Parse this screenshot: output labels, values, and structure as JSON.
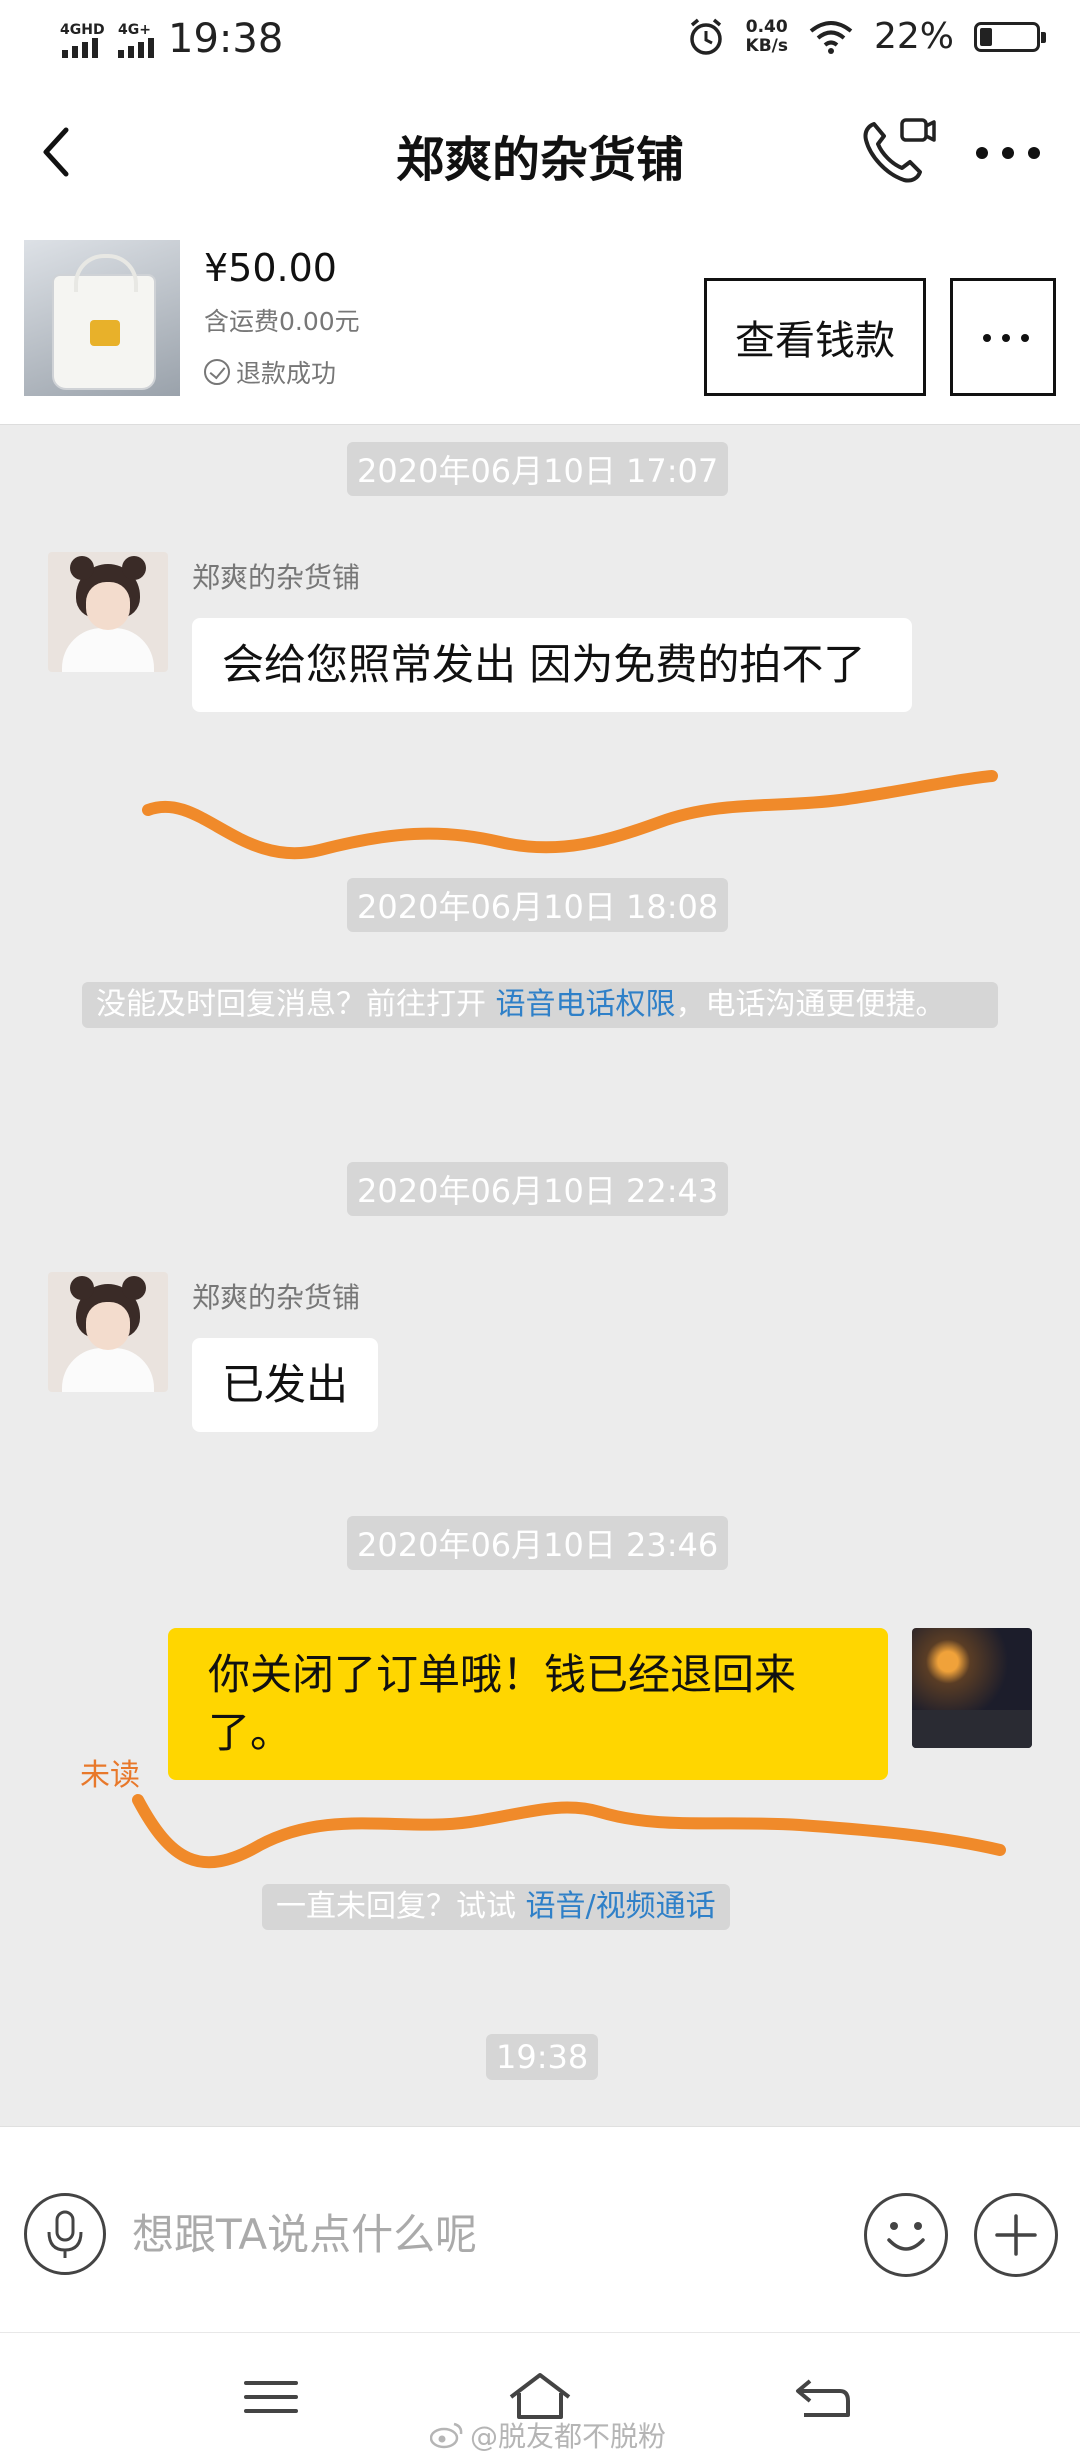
{
  "status_bar": {
    "network_1": "4GHD",
    "network_2": "4G+",
    "time": "19:38",
    "net_speed_value": "0.40",
    "net_speed_unit": "KB/s",
    "battery_percent": "22%",
    "battery_level": 0.22
  },
  "header": {
    "title": "郑爽的杂货铺"
  },
  "product": {
    "price": "¥50.00",
    "shipping": "含运费0.00元",
    "refund_status": "退款成功",
    "view_payment_button": "查看钱款"
  },
  "chat": {
    "timestamps": [
      "2020年06月10日 17:07",
      "2020年06月10日 18:08",
      "2020年06月10日 22:43",
      "2020年06月10日 23:46",
      "19:38"
    ],
    "msg1": {
      "sender": "郑爽的杂货铺",
      "text": "会给您照常发出 因为免费的拍不了"
    },
    "system_notice": {
      "prefix": "没能及时回复消息？前往打开 ",
      "link": "语音电话权限",
      "suffix": "，电话沟通更便捷。"
    },
    "msg2": {
      "sender": "郑爽的杂货铺",
      "text": "已发出"
    },
    "msg3": {
      "text": "你关闭了订单哦！钱已经退回来了。",
      "status": "未读"
    },
    "hint": {
      "prefix": "一直未回复？试试 ",
      "link": "语音/视频通话"
    }
  },
  "input": {
    "placeholder": "想跟TA说点什么呢"
  },
  "watermark": "@脱友都不脱粉",
  "colors": {
    "own_bubble": "#ffd600",
    "link": "#2f80c8",
    "annotation": "#f08a2a",
    "timestamp_bg": "#d6d6d6"
  }
}
